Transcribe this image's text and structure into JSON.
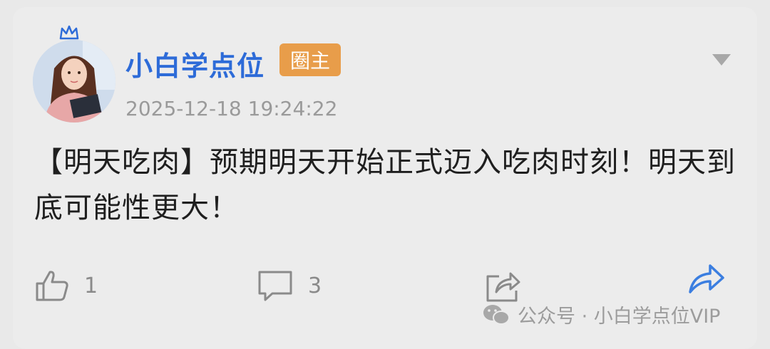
{
  "post": {
    "author": "小白学点位",
    "badge": "圈主",
    "timestamp": "2025-12-18 19:24:22",
    "content": "【明天吃肉】预期明天开始正式迈入吃肉时刻！明天到底可能性更大！"
  },
  "actions": {
    "like_count": "1",
    "comment_count": "3"
  },
  "watermark": {
    "text": "公众号 · 小白学点位VIP"
  },
  "colors": {
    "username": "#2d6bd8",
    "badge_bg": "#e89d4a",
    "forward_icon": "#3b7ee0"
  },
  "icons": [
    "crown-icon",
    "dropdown-triangle-icon",
    "thumbs-up-icon",
    "comment-icon",
    "share-icon",
    "forward-icon",
    "wechat-icon"
  ]
}
